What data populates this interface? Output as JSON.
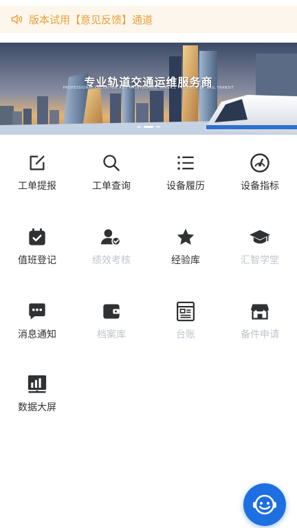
{
  "notice": {
    "text": "版本试用【意见反馈】通道",
    "icon": "speaker-icon"
  },
  "banner": {
    "title": "专业轨道交通运维服务商",
    "subtitle": "PROFESSIONAL OPERATION AND MAINTENANCE SERVICE PROVIDER OF RAIL TRANSIT",
    "slides": 3,
    "active_slide": 1
  },
  "menu": [
    {
      "label": "工单提报",
      "icon": "edit-icon",
      "enabled": true
    },
    {
      "label": "工单查询",
      "icon": "search-icon",
      "enabled": true
    },
    {
      "label": "设备履历",
      "icon": "list-icon",
      "enabled": true
    },
    {
      "label": "设备指标",
      "icon": "gauge-icon",
      "enabled": true
    },
    {
      "label": "值班登记",
      "icon": "calendar-check-icon",
      "enabled": true
    },
    {
      "label": "绩效考核",
      "icon": "user-check-icon",
      "enabled": false
    },
    {
      "label": "经验库",
      "icon": "star-icon",
      "enabled": true
    },
    {
      "label": "汇智学堂",
      "icon": "graduation-cap-icon",
      "enabled": false
    },
    {
      "label": "消息通知",
      "icon": "chat-icon",
      "enabled": true
    },
    {
      "label": "档案库",
      "icon": "wallet-icon",
      "enabled": false
    },
    {
      "label": "台账",
      "icon": "ledger-icon",
      "enabled": false
    },
    {
      "label": "备件申请",
      "icon": "store-icon",
      "enabled": false
    },
    {
      "label": "数据大屏",
      "icon": "chart-board-icon",
      "enabled": true
    }
  ],
  "colors": {
    "notice_text": "#e6a23c",
    "notice_bg": "#fdf6ec",
    "icon_dark": "#303133",
    "icon_disabled": "#c0c4cc",
    "fab": "#1e6fe0"
  },
  "fab": {
    "icon": "robot-assistant-icon"
  }
}
